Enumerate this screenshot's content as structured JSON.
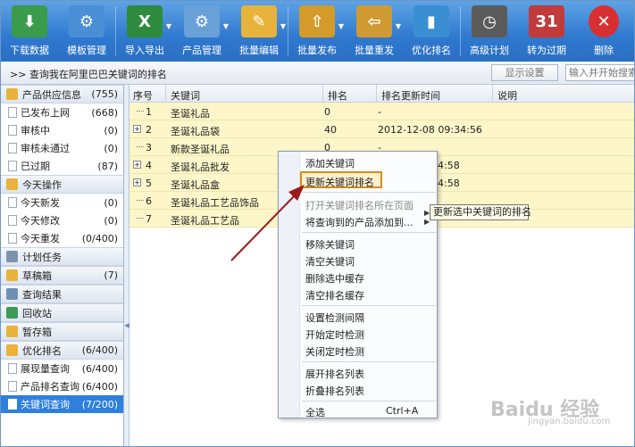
{
  "toolbar": {
    "items": [
      {
        "label": "下载数据",
        "icon": "download-data-icon",
        "color": "#3a9b4a"
      },
      {
        "label": "模板管理",
        "icon": "template-icon",
        "color": "#4a8fd6"
      },
      {
        "label": "导入导出",
        "icon": "excel-icon",
        "color": "#2e8b3e"
      },
      {
        "label": "产品管理",
        "icon": "product-icon",
        "color": "#6aa0d8"
      },
      {
        "label": "批量编辑",
        "icon": "edit-icon",
        "color": "#e8b33a"
      },
      {
        "label": "批量发布",
        "icon": "publish-icon",
        "color": "#d49a2a"
      },
      {
        "label": "批量重发",
        "icon": "republish-icon",
        "color": "#cf9a32"
      },
      {
        "label": "优化排名",
        "icon": "rank-icon",
        "color": "#3a8fd2"
      },
      {
        "label": "高级计划",
        "icon": "clock-icon",
        "color": "#5b5b5b"
      },
      {
        "label": "转为过期",
        "icon": "calendar-icon",
        "color": "#c23a3a"
      },
      {
        "label": "删除",
        "icon": "delete-icon",
        "color": "#d83030"
      }
    ]
  },
  "header": {
    "title": "查询我在阿里巴巴关键词的排名",
    "title_prefix": ">>",
    "display_button": "显示设置",
    "search_placeholder": "输入并开始搜索"
  },
  "sidebar": {
    "supply": {
      "label": "产品供应信息",
      "count": "(755)"
    },
    "supply_items": [
      {
        "label": "已发布上网",
        "count": "(668)"
      },
      {
        "label": "审核中",
        "count": "(0)"
      },
      {
        "label": "审核未通过",
        "count": "(0)"
      },
      {
        "label": "已过期",
        "count": "(87)"
      }
    ],
    "today": {
      "label": "今天操作"
    },
    "today_items": [
      {
        "label": "今天新发",
        "count": "(0)"
      },
      {
        "label": "今天修改",
        "count": "(0)"
      },
      {
        "label": "今天重发",
        "count": "(0/400)"
      }
    ],
    "plan": {
      "label": "计划任务"
    },
    "draft": {
      "label": "草稿箱",
      "count": "(7)"
    },
    "result": {
      "label": "查询结果"
    },
    "recycle": {
      "label": "回收站"
    },
    "archive": {
      "label": "暂存箱"
    },
    "optimize": {
      "label": "优化排名",
      "count": "(6/400)"
    },
    "optimize_items": [
      {
        "label": "展现量查询",
        "count": "(6/400)"
      },
      {
        "label": "产品排名查询",
        "count": "(6/400)"
      },
      {
        "label": "关键词查询",
        "count": "(7/200)"
      }
    ]
  },
  "grid": {
    "headers": {
      "num": "序号",
      "keyword": "关键词",
      "rank": "排名",
      "time": "排名更新时间",
      "desc": "说明"
    },
    "rows": [
      {
        "num": "1",
        "keyword": "圣诞礼品",
        "rank": "0",
        "time": "-"
      },
      {
        "num": "2",
        "keyword": "圣诞礼品袋",
        "rank": "40",
        "time": "2012-12-08 09:34:56"
      },
      {
        "num": "3",
        "keyword": "新款圣诞礼品",
        "rank": "0",
        "time": "-"
      },
      {
        "num": "4",
        "keyword": "圣诞礼品批发",
        "rank": "",
        "time": "34:58"
      },
      {
        "num": "5",
        "keyword": "圣诞礼品盒",
        "rank": "",
        "time": "34:58"
      },
      {
        "num": "6",
        "keyword": "圣诞礼品工艺品饰品",
        "rank": "",
        "time": ""
      },
      {
        "num": "7",
        "keyword": "圣诞礼品工艺品",
        "rank": "",
        "time": ""
      }
    ]
  },
  "context_menu": {
    "group1": [
      "添加关键词",
      "更新关键词排名"
    ],
    "group2": [
      "打开关键词排名所在页面",
      "将查询到的产品添加到..."
    ],
    "group3": [
      "移除关键词",
      "清空关键词",
      "删除选中缓存",
      "清空排名缓存"
    ],
    "group4": [
      "设置检测间隔",
      "开始定时检测",
      "关闭定时检测"
    ],
    "group5": [
      "展开排名列表",
      "折叠排名列表"
    ],
    "select_all": {
      "label": "全选",
      "shortcut": "Ctrl+A"
    }
  },
  "tooltip": "更新选中关键词的排名",
  "watermark": {
    "text": "Baidu 经验",
    "sub": "jingyan.baidu.com"
  }
}
